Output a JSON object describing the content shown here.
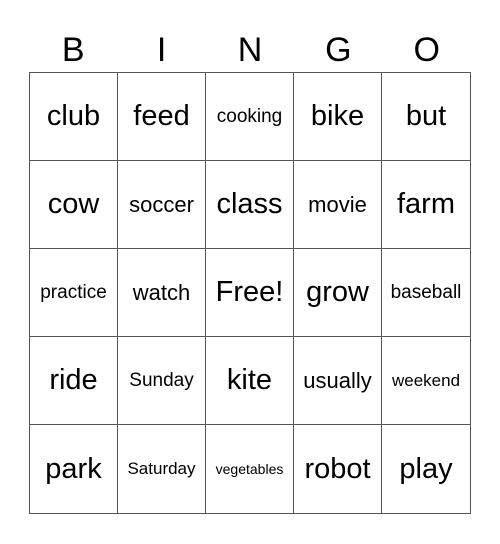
{
  "header": [
    "B",
    "I",
    "N",
    "G",
    "O"
  ],
  "cells": [
    {
      "text": "club",
      "size": "s2"
    },
    {
      "text": "feed",
      "size": "s2"
    },
    {
      "text": "cooking",
      "size": "s4"
    },
    {
      "text": "bike",
      "size": "s2"
    },
    {
      "text": "but",
      "size": "s2"
    },
    {
      "text": "cow",
      "size": "s2"
    },
    {
      "text": "soccer",
      "size": "s3"
    },
    {
      "text": "class",
      "size": "s2"
    },
    {
      "text": "movie",
      "size": "s3"
    },
    {
      "text": "farm",
      "size": "s2"
    },
    {
      "text": "practice",
      "size": "s4"
    },
    {
      "text": "watch",
      "size": "s3"
    },
    {
      "text": "Free!",
      "size": "s2"
    },
    {
      "text": "grow",
      "size": "s2"
    },
    {
      "text": "baseball",
      "size": "s4"
    },
    {
      "text": "ride",
      "size": "s2"
    },
    {
      "text": "Sunday",
      "size": "s4"
    },
    {
      "text": "kite",
      "size": "s2"
    },
    {
      "text": "usually",
      "size": "s3"
    },
    {
      "text": "weekend",
      "size": "s5"
    },
    {
      "text": "park",
      "size": "s2"
    },
    {
      "text": "Saturday",
      "size": "s5"
    },
    {
      "text": "vegetables",
      "size": "s6"
    },
    {
      "text": "robot",
      "size": "s2"
    },
    {
      "text": "play",
      "size": "s2"
    }
  ]
}
